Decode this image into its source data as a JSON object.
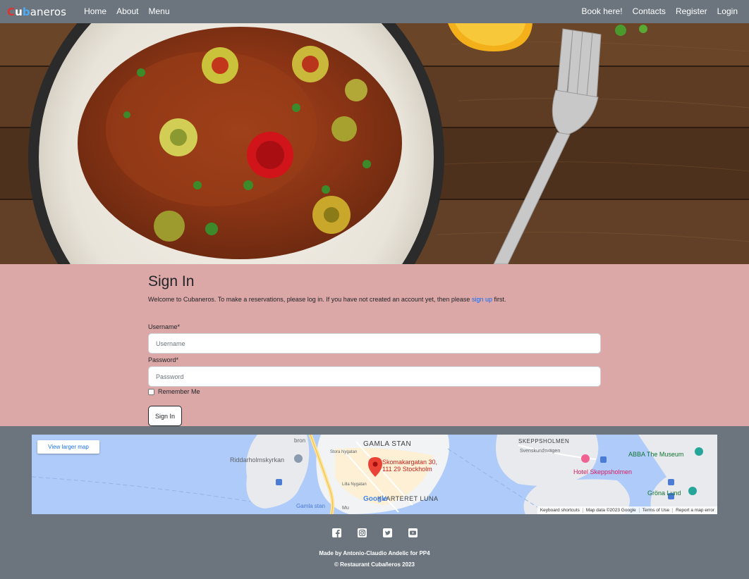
{
  "nav": {
    "brand_c": "C",
    "brand_u": "u",
    "brand_b": "b",
    "brand_rest": "aneros",
    "left": [
      "Home",
      "About",
      "Menu"
    ],
    "right": [
      "Book here!",
      "Contacts",
      "Register",
      "Login"
    ]
  },
  "signin": {
    "title": "Sign In",
    "welcome_before": "Welcome to Cubaneros. To make a reservations, please log in. If you have not created an account yet, then please ",
    "signup_link": "sign up",
    "welcome_after": " first.",
    "username_label": "Username*",
    "username_placeholder": "Username",
    "password_label": "Password*",
    "password_placeholder": "Password",
    "remember_label": "Remember Me",
    "button": "Sign In"
  },
  "map": {
    "larger_map": "View larger map",
    "labels": {
      "gamla_stan": "GAMLA STAN",
      "skeppsholmen": "SKEPPSHOLMEN",
      "riddarholm": "Riddarholmskyrkan",
      "address_1": "Skomakargatan 30,",
      "address_2": "111 29 Stockholm",
      "abba": "ABBA The Museum",
      "hotel": "Hotel Skeppsholmen",
      "grona": "Gröna Lund",
      "kvarteret": "KVARTERET LUNA",
      "gamla_stan_station": "Gamla stan",
      "svenskund": "Svenskundsvägen",
      "stora_nygatan": "Stora Nygatan",
      "lilla_nygatan": "Lilla Nygatan",
      "bron": "bron",
      "mu": "Mu",
      "google": "Google"
    },
    "footer": [
      "Keyboard shortcuts",
      "Map data ©2023 Google",
      "Terms of Use",
      "Report a map error"
    ]
  },
  "footer": {
    "social": [
      "facebook-icon",
      "instagram-icon",
      "twitter-icon",
      "youtube-icon"
    ],
    "made_by": "Made by Antonio-Claudio Andelic for PP4",
    "copyright": "© Restaurant Cubañeros 2023"
  }
}
